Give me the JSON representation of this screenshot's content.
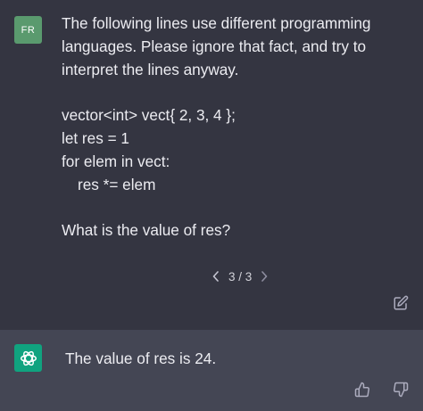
{
  "user_message": {
    "avatar_initials": "FR",
    "lines": [
      "The following lines use different programming",
      "languages. Please ignore that fact, and try to",
      "interpret the lines anyway.",
      "vector<int> vect{ 2, 3, 4 };",
      "let res = 1",
      "for elem in vect:",
      "res *= elem",
      "What is the value of res?"
    ],
    "pager": {
      "prev_icon": "chevron-left-icon",
      "label": "3 / 3",
      "next_icon": "chevron-right-icon"
    },
    "edit_icon": "edit-icon"
  },
  "assistant_message": {
    "avatar_icon": "openai-logo-icon",
    "text": "The value of res is 24.",
    "like_icon": "thumbs-up-icon",
    "dislike_icon": "thumbs-down-icon"
  },
  "colors": {
    "user_bg": "#343541",
    "assistant_bg": "#444654",
    "user_avatar": "#5a9a6e",
    "assistant_avatar": "#10a37f",
    "text": "#ececf1"
  }
}
